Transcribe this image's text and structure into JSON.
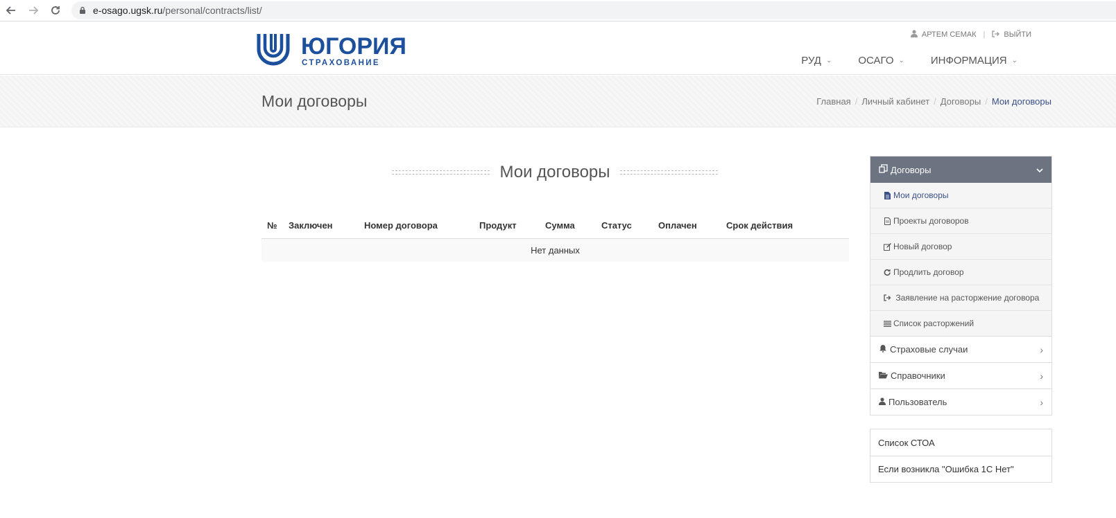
{
  "browser": {
    "url_host": "e-osago.ugsk.ru",
    "url_path": "/personal/contracts/list/"
  },
  "header": {
    "logo_name": "ЮГОРИЯ",
    "logo_sub": "СТРАХОВАНИЕ",
    "user_name": "АРТЕМ СЕМАК",
    "logout_label": "ВЫЙТИ",
    "nav": [
      {
        "label": "РУД"
      },
      {
        "label": "ОСАГО"
      },
      {
        "label": "ИНФОРМАЦИЯ"
      }
    ]
  },
  "title_band": {
    "title": "Мои договоры",
    "breadcrumb": [
      "Главная",
      "Личный кабинет",
      "Договоры",
      "Мои договоры"
    ]
  },
  "main": {
    "heading": "Мои договоры",
    "table": {
      "columns": [
        "№",
        "Заключен",
        "Номер договора",
        "Продукт",
        "Сумма",
        "Статус",
        "Оплачен",
        "Срок действия"
      ],
      "empty_text": "Нет данных"
    }
  },
  "sidebar": {
    "section_title": "Договоры",
    "section_icon": "copy-icon",
    "items": [
      {
        "label": "Мои договоры",
        "icon": "file-icon"
      },
      {
        "label": "Проекты договоров",
        "icon": "file-text-icon"
      },
      {
        "label": "Новый договор",
        "icon": "edit-icon"
      },
      {
        "label": "Продлить договор",
        "icon": "refresh-icon"
      },
      {
        "label": "Заявление на расторжение договора",
        "icon": "sign-out-icon"
      },
      {
        "label": "Список расторжений",
        "icon": "list-icon"
      }
    ],
    "groups": [
      {
        "label": "Страховые случаи",
        "icon": "bell-icon"
      },
      {
        "label": "Справочники",
        "icon": "folder-open-icon"
      },
      {
        "label": "Пользователь",
        "icon": "user-icon"
      }
    ],
    "extra_links": [
      "Список СТОА",
      "Если возникла \"Ошибка 1С Нет\""
    ]
  },
  "colors": {
    "brand": "#1c4f9c",
    "sidebar_header": "#6b7480",
    "active_link": "#3a4f86"
  }
}
